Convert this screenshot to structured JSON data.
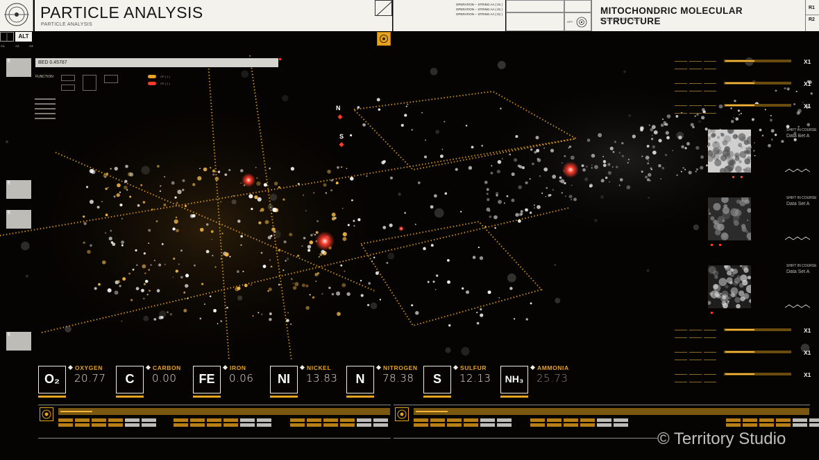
{
  "header": {
    "title": "PARTICLE ANALYSIS",
    "subtitle": "PARTICLE ANALYSIS",
    "operations": [
      "OPERATION -- STRING AA ( 01 )",
      "OPERATION -- STRING AA ( 01 )",
      "OPERATION -- STRING AA ( 01 )"
    ],
    "right_title": "MITOCHONDRIC MOLECULAR STRUCTURE",
    "right_subtitle": "HYDROPONIC DATA",
    "opt_label": "OPT",
    "r1": "R1",
    "r2": "R2"
  },
  "left": {
    "alt": "ALT",
    "a_labels": [
      "A1",
      "A2",
      "A3"
    ],
    "bed": "BED 0.45787",
    "function": "FUNCTION",
    "toggles": [
      "OP ( 1 )",
      "OP ( 1 )"
    ]
  },
  "elements": [
    {
      "symbol": "O₂",
      "name": "OXYGEN",
      "value": "20.77"
    },
    {
      "symbol": "C",
      "name": "CARBON",
      "value": "0.00"
    },
    {
      "symbol": "FE",
      "name": "IRON",
      "value": "0.06"
    },
    {
      "symbol": "NI",
      "name": "NICKEL",
      "value": "13.83"
    },
    {
      "symbol": "N",
      "name": "NITROGEN",
      "value": "78.38"
    },
    {
      "symbol": "S",
      "name": "SULFUR",
      "value": "12.13"
    },
    {
      "symbol": "NH₃",
      "name": "AMMONIA",
      "value": "25.73"
    }
  ],
  "right": {
    "multipliers": [
      "X1",
      "X1",
      "X1",
      "X1",
      "X1",
      "X1"
    ],
    "thumbs": [
      {
        "title": "SHIFT IN COURSE",
        "set": "Data Set A"
      },
      {
        "title": "SHIFT IN COURSE",
        "set": "Data Set A"
      },
      {
        "title": "SHIFT IN COURSE",
        "set": "Data Set A"
      }
    ]
  },
  "viz": {
    "compass_n": "N",
    "compass_s": "S"
  },
  "watermark": "© Territory Studio",
  "colors": {
    "accent": "#e8a31f",
    "panel": "#f4f2ec",
    "background": "#060402",
    "alert": "#ff3a2a"
  }
}
